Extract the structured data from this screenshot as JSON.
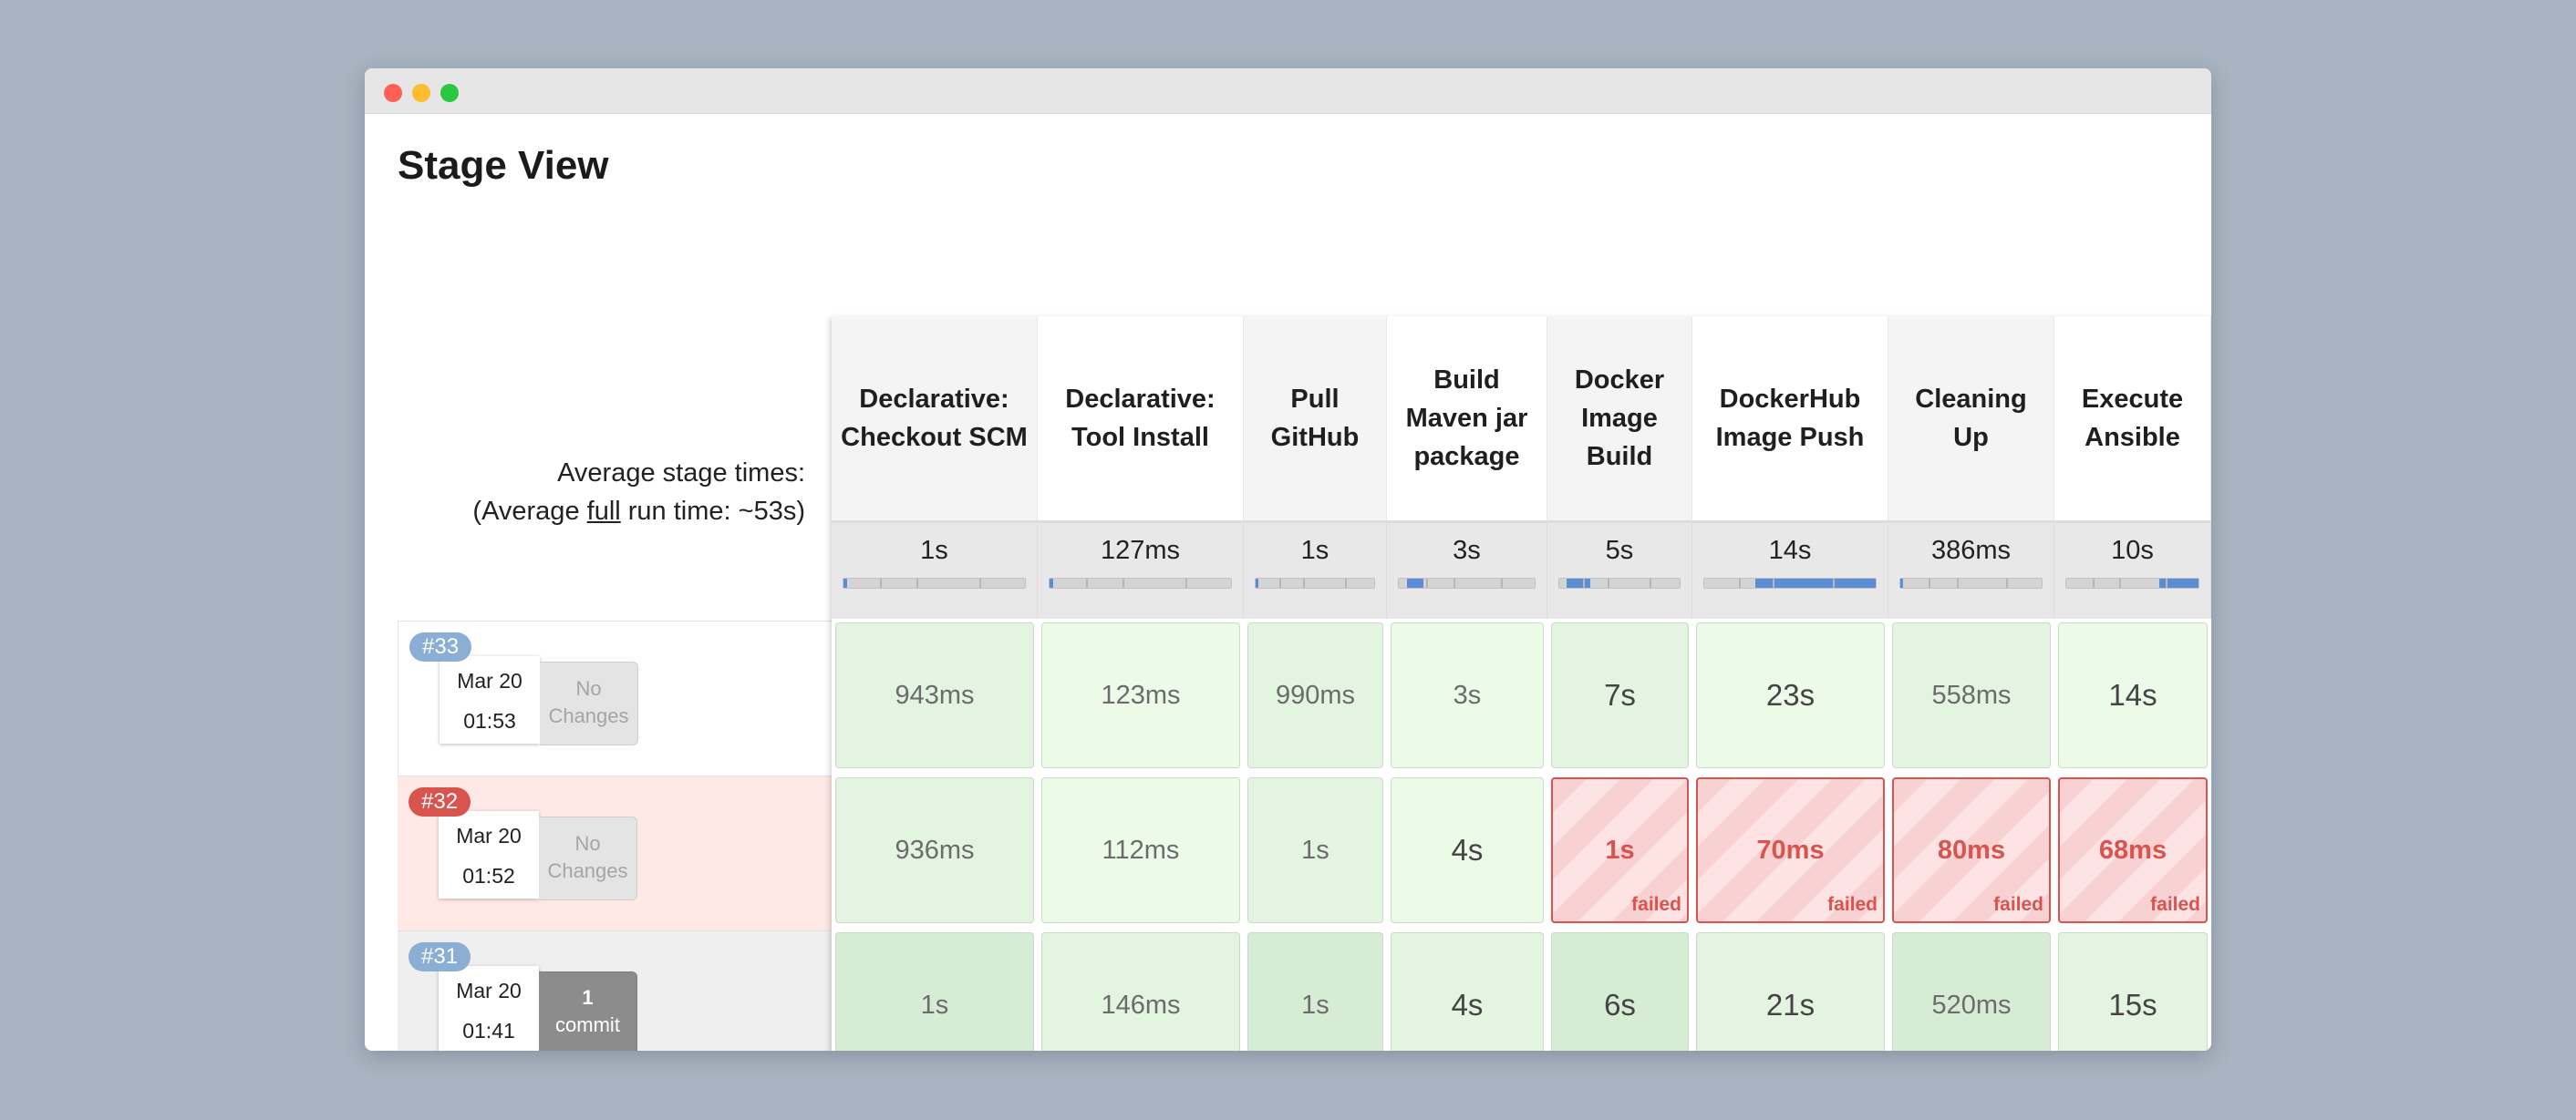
{
  "window": {
    "controls": [
      "close",
      "minimize",
      "zoom"
    ]
  },
  "page": {
    "title": "Stage View"
  },
  "average": {
    "line1": "Average stage times:",
    "prefix": "(Average ",
    "link": "full",
    "suffix": " run time: ~53s)"
  },
  "stages": [
    {
      "name": "Declarative: Checkout SCM",
      "avg": "1s",
      "progress": 0.0
    },
    {
      "name": "Declarative: Tool Install",
      "avg": "127ms",
      "progress": 0.0
    },
    {
      "name": "Pull GitHub",
      "avg": "1s",
      "progress": 0.0
    },
    {
      "name": "Build Maven jar package",
      "avg": "3s",
      "progress": 0.12
    },
    {
      "name": "Docker Image Build",
      "avg": "5s",
      "progress": 0.2
    },
    {
      "name": "DockerHub Image Push",
      "avg": "14s",
      "progress": 0.7
    },
    {
      "name": "Cleaning Up",
      "avg": "386ms",
      "progress": 0.0
    },
    {
      "name": "Execute Ansible",
      "avg": "10s",
      "progress": 0.3
    }
  ],
  "builds": [
    {
      "number": "#33",
      "status": "success",
      "date": "Mar 20",
      "time": "01:53",
      "changes": {
        "type": "none",
        "line1": "No",
        "line2": "Changes"
      },
      "cells": [
        {
          "value": "943ms",
          "status": "success"
        },
        {
          "value": "123ms",
          "status": "success"
        },
        {
          "value": "990ms",
          "status": "success"
        },
        {
          "value": "3s",
          "status": "success"
        },
        {
          "value": "7s",
          "status": "success"
        },
        {
          "value": "23s",
          "status": "success"
        },
        {
          "value": "558ms",
          "status": "success"
        },
        {
          "value": "14s",
          "status": "success"
        }
      ]
    },
    {
      "number": "#32",
      "status": "failed",
      "date": "Mar 20",
      "time": "01:52",
      "changes": {
        "type": "none",
        "line1": "No",
        "line2": "Changes"
      },
      "cells": [
        {
          "value": "936ms",
          "status": "success"
        },
        {
          "value": "112ms",
          "status": "success"
        },
        {
          "value": "1s",
          "status": "success"
        },
        {
          "value": "4s",
          "status": "success"
        },
        {
          "value": "1s",
          "status": "failed",
          "label": "failed"
        },
        {
          "value": "70ms",
          "status": "failed",
          "label": "failed"
        },
        {
          "value": "80ms",
          "status": "failed",
          "label": "failed"
        },
        {
          "value": "68ms",
          "status": "failed",
          "label": "failed"
        }
      ]
    },
    {
      "number": "#31",
      "status": "success",
      "date": "Mar 20",
      "time": "01:41",
      "changes": {
        "type": "commit",
        "line1": "1",
        "line2": "commit"
      },
      "cells": [
        {
          "value": "1s",
          "status": "success"
        },
        {
          "value": "146ms",
          "status": "success"
        },
        {
          "value": "1s",
          "status": "success"
        },
        {
          "value": "4s",
          "status": "success"
        },
        {
          "value": "6s",
          "status": "success"
        },
        {
          "value": "21s",
          "status": "success"
        },
        {
          "value": "520ms",
          "status": "success"
        },
        {
          "value": "15s",
          "status": "success"
        }
      ]
    }
  ],
  "colors": {
    "failed": "#d9534f",
    "badge_blue": "#8aaed4",
    "success_bg": "#e3f4e0",
    "progress": "#5a8fd6"
  }
}
